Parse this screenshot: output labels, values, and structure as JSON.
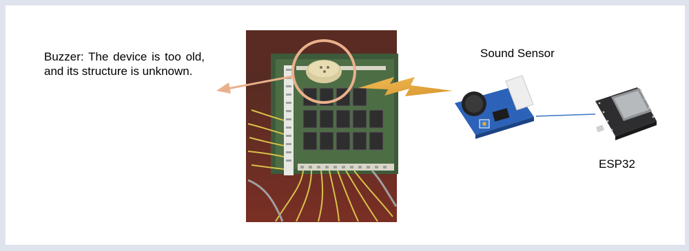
{
  "caption": {
    "buzzer_note": "Buzzer: The device is too old, and its structure is unknown."
  },
  "labels": {
    "sound_sensor": "Sound Sensor",
    "esp32": "ESP32"
  },
  "colors": {
    "background": "#dfe3ee",
    "callout_circle": "#eab08c",
    "callout_arrow": "#eab08c",
    "signal_bolt": "#e2a63c",
    "sensor_board": "#2c62b8",
    "connector_line": "#3a74c2",
    "esp32_board": "#2e2e30",
    "panel_photo": "#35302a"
  },
  "icons": {
    "photo": "relay-panel-photo",
    "signal": "lightning-bolt-icon",
    "sensor": "sound-sensor-module-icon",
    "controller": "esp32-board-icon"
  }
}
